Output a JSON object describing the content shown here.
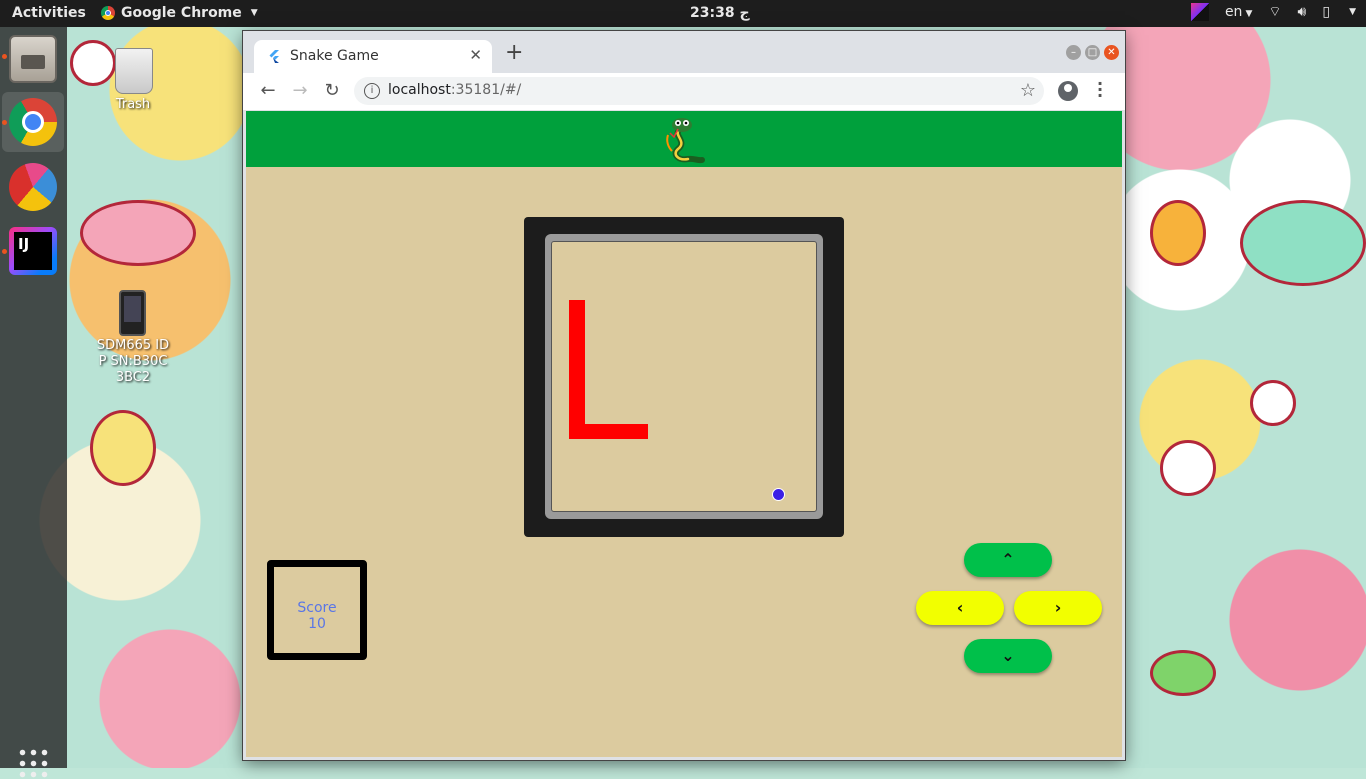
{
  "topbar": {
    "activities": "Activities",
    "app_name": "Google Chrome",
    "clock": "ج 23:38",
    "language": "en"
  },
  "desktop": {
    "trash_label": "Trash",
    "device_label": "SDM665 IDP SN:B30C3BC2"
  },
  "browser": {
    "tab_title": "Snake Game",
    "url_host": "localhost",
    "url_rest": ":35181/#/"
  },
  "game": {
    "score_label": "Score",
    "score_value": "10",
    "snake_color": "#ff0000",
    "food_color": "#3b1fe6",
    "appbar_color": "#00a03c",
    "background_color": "#dccb9f"
  },
  "controls": {
    "up": "⌃",
    "left": "‹",
    "right": "›",
    "down": "⌄"
  }
}
